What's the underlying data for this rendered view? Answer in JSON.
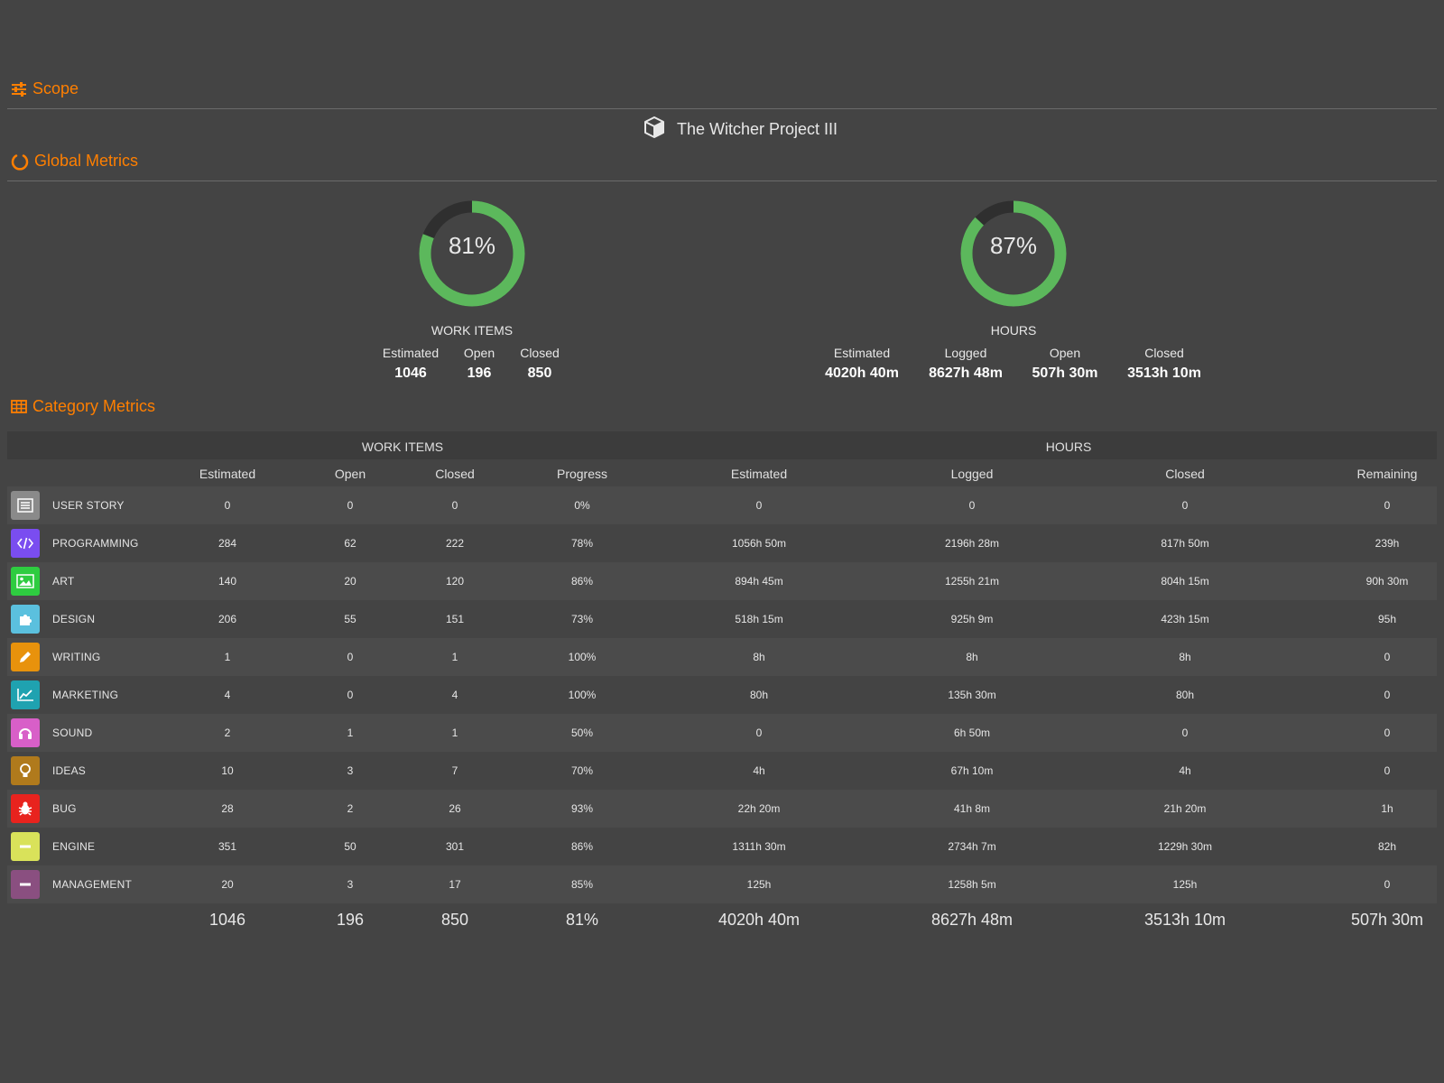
{
  "sections": {
    "scope": "Scope",
    "global_metrics": "Global Metrics",
    "category_metrics": "Category Metrics"
  },
  "project": {
    "name": "The Witcher Project III",
    "icon": "cube-icon"
  },
  "colors": {
    "accent": "#ff7f00",
    "gauge_fill": "#5cb85c",
    "gauge_track": "#2f2f2f"
  },
  "global": {
    "work_items": {
      "percent": 0.81,
      "percent_label": "81%",
      "label": "WORK ITEMS",
      "stats": [
        {
          "label": "Estimated",
          "value": "1046"
        },
        {
          "label": "Open",
          "value": "196"
        },
        {
          "label": "Closed",
          "value": "850"
        }
      ]
    },
    "hours": {
      "percent": 0.87,
      "percent_label": "87%",
      "label": "HOURS",
      "stats": [
        {
          "label": "Estimated",
          "value": "4020h 40m"
        },
        {
          "label": "Logged",
          "value": "8627h 48m"
        },
        {
          "label": "Open",
          "value": "507h 30m"
        },
        {
          "label": "Closed",
          "value": "3513h 10m"
        }
      ]
    }
  },
  "table": {
    "groups": {
      "work_items": "WORK ITEMS",
      "hours": "HOURS"
    },
    "columns": [
      "Estimated",
      "Open",
      "Closed",
      "Progress",
      "Estimated",
      "Logged",
      "Closed",
      "Remaining"
    ],
    "rows": [
      {
        "name": "USER STORY",
        "icon": "list-icon",
        "color": "#8a8a8a",
        "values": [
          "0",
          "0",
          "0",
          "0%",
          "0",
          "0",
          "0",
          "0"
        ]
      },
      {
        "name": "PROGRAMMING",
        "icon": "code-icon",
        "color": "#7a4df0",
        "values": [
          "284",
          "62",
          "222",
          "78%",
          "1056h 50m",
          "2196h 28m",
          "817h 50m",
          "239h"
        ]
      },
      {
        "name": "ART",
        "icon": "image-icon",
        "color": "#2ecc40",
        "values": [
          "140",
          "20",
          "120",
          "86%",
          "894h 45m",
          "1255h 21m",
          "804h 15m",
          "90h 30m"
        ]
      },
      {
        "name": "DESIGN",
        "icon": "puzzle-icon",
        "color": "#5bc0de",
        "values": [
          "206",
          "55",
          "151",
          "73%",
          "518h 15m",
          "925h 9m",
          "423h 15m",
          "95h"
        ]
      },
      {
        "name": "WRITING",
        "icon": "pencil-icon",
        "color": "#e8920c",
        "values": [
          "1",
          "0",
          "1",
          "100%",
          "8h",
          "8h",
          "8h",
          "0"
        ]
      },
      {
        "name": "MARKETING",
        "icon": "line-chart-icon",
        "color": "#1fa2b0",
        "values": [
          "4",
          "0",
          "4",
          "100%",
          "80h",
          "135h 30m",
          "80h",
          "0"
        ]
      },
      {
        "name": "SOUND",
        "icon": "headphones-icon",
        "color": "#d85fc8",
        "values": [
          "2",
          "1",
          "1",
          "50%",
          "0",
          "6h 50m",
          "0",
          "0"
        ]
      },
      {
        "name": "IDEAS",
        "icon": "lightbulb-icon",
        "color": "#b07a1c",
        "values": [
          "10",
          "3",
          "7",
          "70%",
          "4h",
          "67h 10m",
          "4h",
          "0"
        ]
      },
      {
        "name": "BUG",
        "icon": "bug-icon",
        "color": "#e8231e",
        "values": [
          "28",
          "2",
          "26",
          "93%",
          "22h 20m",
          "41h 8m",
          "21h 20m",
          "1h"
        ]
      },
      {
        "name": "ENGINE",
        "icon": "minus-icon",
        "color": "#d9e25a",
        "values": [
          "351",
          "50",
          "301",
          "86%",
          "1311h 30m",
          "2734h 7m",
          "1229h 30m",
          "82h"
        ]
      },
      {
        "name": "MANAGEMENT",
        "icon": "minus-icon",
        "color": "#8a4f80",
        "values": [
          "20",
          "3",
          "17",
          "85%",
          "125h",
          "1258h 5m",
          "125h",
          "0"
        ]
      }
    ],
    "totals": [
      "1046",
      "196",
      "850",
      "81%",
      "4020h 40m",
      "8627h 48m",
      "3513h 10m",
      "507h 30m"
    ]
  }
}
